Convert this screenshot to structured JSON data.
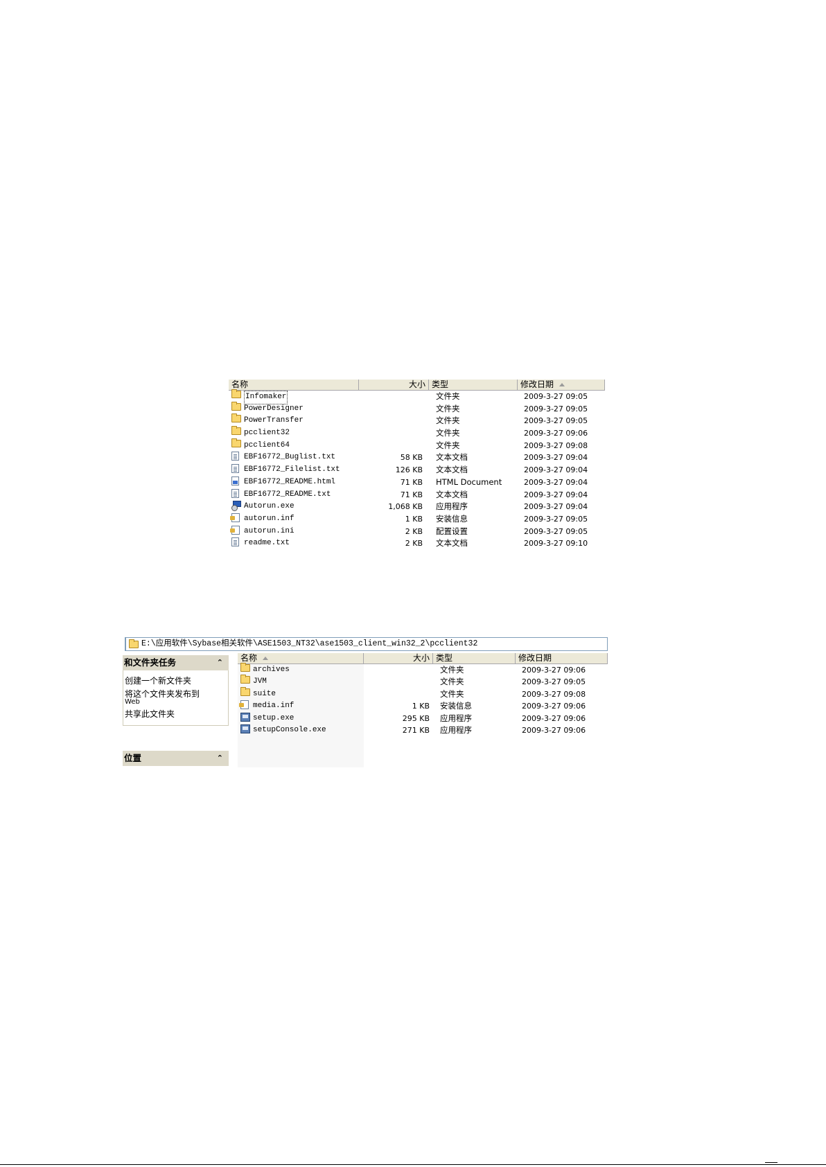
{
  "screenshot1": {
    "columns": {
      "name": "名称",
      "size": "大小",
      "type": "类型",
      "modified": "修改日期"
    },
    "files": [
      {
        "icon": "folder-icon",
        "name": "Infomaker",
        "size": "",
        "type": "文件夹",
        "modified": "2009-3-27 09:05",
        "selected": true
      },
      {
        "icon": "folder-icon",
        "name": "PowerDesigner",
        "size": "",
        "type": "文件夹",
        "modified": "2009-3-27 09:05"
      },
      {
        "icon": "folder-icon",
        "name": "PowerTransfer",
        "size": "",
        "type": "文件夹",
        "modified": "2009-3-27 09:05"
      },
      {
        "icon": "folder-icon",
        "name": "pcclient32",
        "size": "",
        "type": "文件夹",
        "modified": "2009-3-27 09:06"
      },
      {
        "icon": "folder-icon",
        "name": "pcclient64",
        "size": "",
        "type": "文件夹",
        "modified": "2009-3-27 09:08"
      },
      {
        "icon": "text-document-icon",
        "name": "EBF16772_Buglist.txt",
        "size": "58 KB",
        "type": "文本文档",
        "modified": "2009-3-27 09:04"
      },
      {
        "icon": "text-document-icon",
        "name": "EBF16772_Filelist.txt",
        "size": "126 KB",
        "type": "文本文档",
        "modified": "2009-3-27 09:04"
      },
      {
        "icon": "html-document-icon",
        "name": "EBF16772_README.html",
        "size": "71 KB",
        "type": "HTML Document",
        "modified": "2009-3-27 09:04"
      },
      {
        "icon": "text-document-icon",
        "name": "EBF16772_README.txt",
        "size": "71 KB",
        "type": "文本文档",
        "modified": "2009-3-27 09:04"
      },
      {
        "icon": "autorun-exe-icon",
        "name": "Autorun.exe",
        "size": "1,068 KB",
        "type": "应用程序",
        "modified": "2009-3-27 09:04"
      },
      {
        "icon": "setup-info-icon",
        "name": "autorun.inf",
        "size": "1 KB",
        "type": "安装信息",
        "modified": "2009-3-27 09:05"
      },
      {
        "icon": "config-settings-icon",
        "name": "autorun.ini",
        "size": "2 KB",
        "type": "配置设置",
        "modified": "2009-3-27 09:05"
      },
      {
        "icon": "text-document-icon",
        "name": "readme.txt",
        "size": "2 KB",
        "type": "文本文档",
        "modified": "2009-3-27 09:10"
      }
    ]
  },
  "screenshot2": {
    "address": "E:\\应用软件\\Sybase相关软件\\ASE1503_NT32\\ase1503_client_win32_2\\pcclient32",
    "tasks_panel": {
      "title": "和文件夹任务",
      "items": [
        "创建一个新文件夹",
        "将这个文件夹发布到",
        "Web",
        "共享此文件夹"
      ]
    },
    "places_panel": {
      "title": "位置"
    },
    "columns": {
      "name": "名称",
      "size": "大小",
      "type": "类型",
      "modified": "修改日期"
    },
    "files": [
      {
        "icon": "folder-icon",
        "name": "archives",
        "size": "",
        "type": "文件夹",
        "modified": "2009-3-27 09:06"
      },
      {
        "icon": "folder-icon",
        "name": "JVM",
        "size": "",
        "type": "文件夹",
        "modified": "2009-3-27 09:05"
      },
      {
        "icon": "folder-icon",
        "name": "suite",
        "size": "",
        "type": "文件夹",
        "modified": "2009-3-27 09:08"
      },
      {
        "icon": "setup-info-icon",
        "name": "media.inf",
        "size": "1 KB",
        "type": "安装信息",
        "modified": "2009-3-27 09:06"
      },
      {
        "icon": "setup-exe-icon",
        "name": "setup.exe",
        "size": "295 KB",
        "type": "应用程序",
        "modified": "2009-3-27 09:06"
      },
      {
        "icon": "setup-exe-icon",
        "name": "setupConsole.exe",
        "size": "271 KB",
        "type": "应用程序",
        "modified": "2009-3-27 09:06"
      }
    ]
  }
}
